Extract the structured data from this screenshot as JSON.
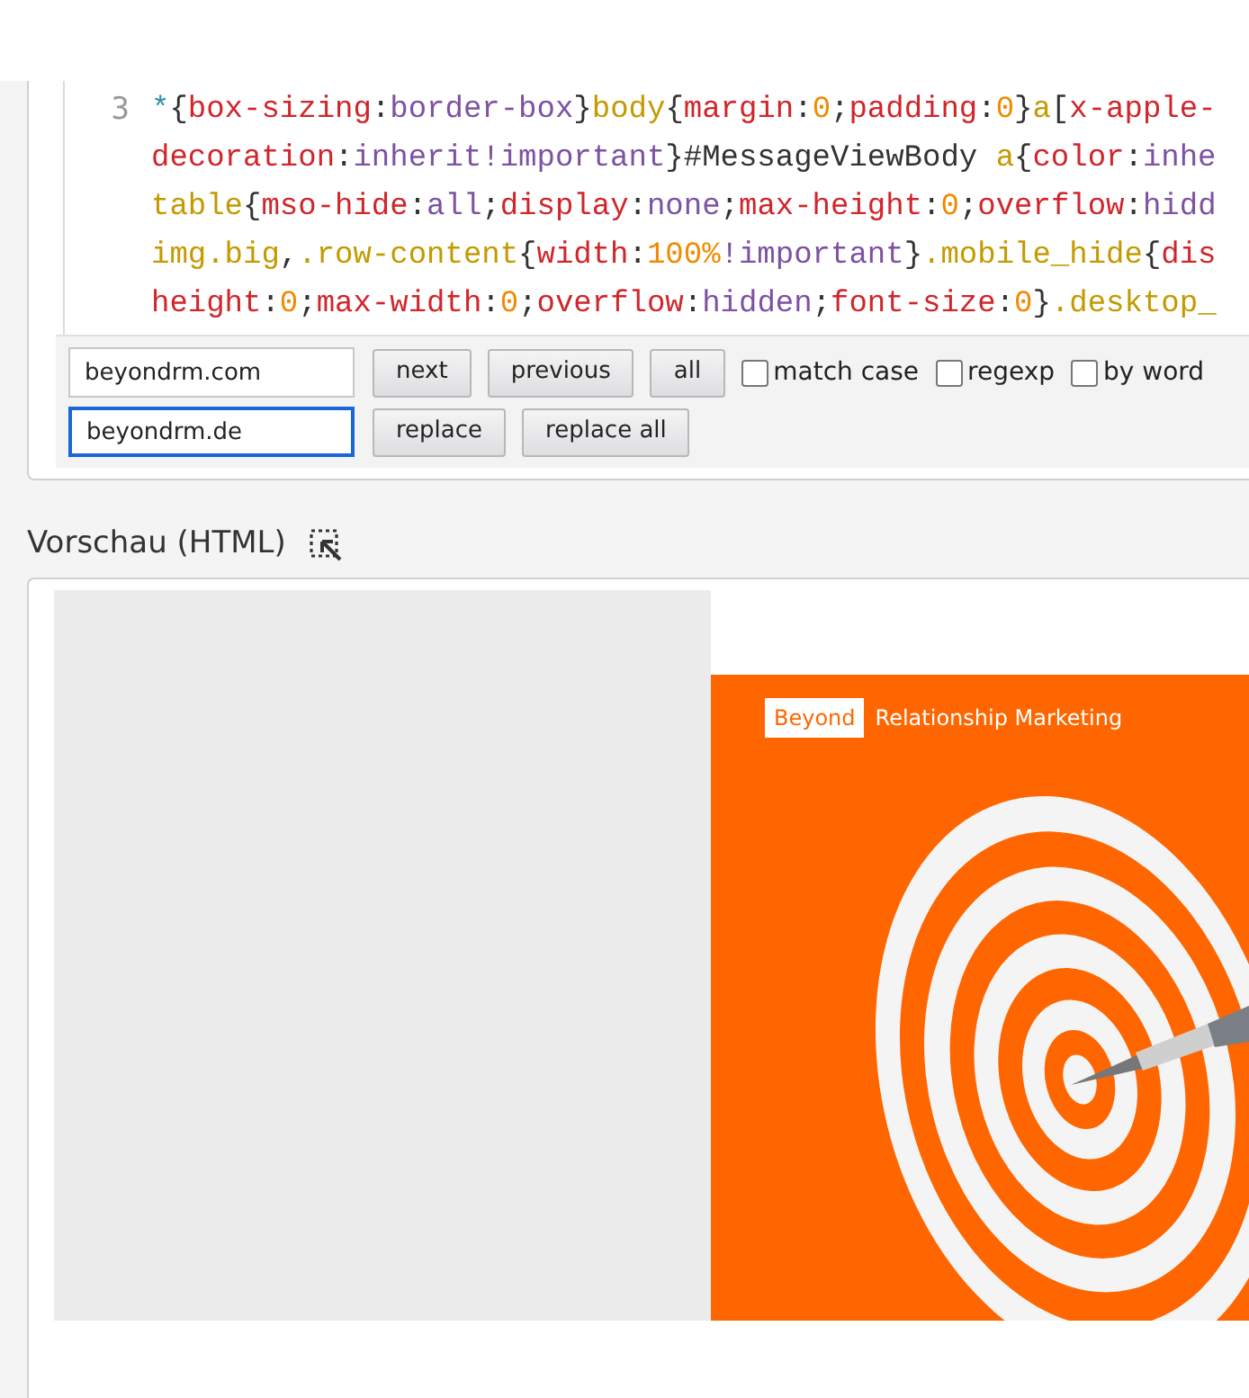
{
  "code_editor": {
    "lines": [
      {
        "number": "3",
        "rows": [
          {
            "tokens": [
              {
                "kind": "star",
                "text": "*"
              },
              {
                "kind": "punct",
                "text": "{"
              },
              {
                "kind": "prop",
                "text": "box-sizing"
              },
              {
                "kind": "punct",
                "text": ":"
              },
              {
                "kind": "value",
                "text": "border-box"
              },
              {
                "kind": "punct",
                "text": "}"
              },
              {
                "kind": "tag",
                "text": "body"
              },
              {
                "kind": "punct",
                "text": "{"
              },
              {
                "kind": "prop",
                "text": "margin"
              },
              {
                "kind": "punct",
                "text": ":"
              },
              {
                "kind": "num",
                "text": "0"
              },
              {
                "kind": "punct",
                "text": ";"
              },
              {
                "kind": "prop",
                "text": "padding"
              },
              {
                "kind": "punct",
                "text": ":"
              },
              {
                "kind": "num",
                "text": "0"
              },
              {
                "kind": "punct",
                "text": "}"
              },
              {
                "kind": "tag",
                "text": "a"
              },
              {
                "kind": "punct",
                "text": "["
              },
              {
                "kind": "prop",
                "text": "x-apple-"
              }
            ]
          },
          {
            "tokens": [
              {
                "kind": "prop",
                "text": "decoration"
              },
              {
                "kind": "punct",
                "text": ":"
              },
              {
                "kind": "value",
                "text": "inherit!important"
              },
              {
                "kind": "punct",
                "text": "}#MessageViewBody "
              },
              {
                "kind": "tag",
                "text": "a"
              },
              {
                "kind": "punct",
                "text": "{"
              },
              {
                "kind": "prop",
                "text": "color"
              },
              {
                "kind": "punct",
                "text": ":"
              },
              {
                "kind": "value",
                "text": "inhe"
              }
            ]
          },
          {
            "tokens": [
              {
                "kind": "tag",
                "text": "table"
              },
              {
                "kind": "punct",
                "text": "{"
              },
              {
                "kind": "prop",
                "text": "mso-hide"
              },
              {
                "kind": "punct",
                "text": ":"
              },
              {
                "kind": "value",
                "text": "all"
              },
              {
                "kind": "punct",
                "text": ";"
              },
              {
                "kind": "prop",
                "text": "display"
              },
              {
                "kind": "punct",
                "text": ":"
              },
              {
                "kind": "value",
                "text": "none"
              },
              {
                "kind": "punct",
                "text": ";"
              },
              {
                "kind": "prop",
                "text": "max-height"
              },
              {
                "kind": "punct",
                "text": ":"
              },
              {
                "kind": "num",
                "text": "0"
              },
              {
                "kind": "punct",
                "text": ";"
              },
              {
                "kind": "prop",
                "text": "overflow"
              },
              {
                "kind": "punct",
                "text": ":"
              },
              {
                "kind": "value",
                "text": "hidd"
              }
            ]
          },
          {
            "tokens": [
              {
                "kind": "tag",
                "text": "img.big"
              },
              {
                "kind": "punct",
                "text": ","
              },
              {
                "kind": "tag",
                "text": ".row-content"
              },
              {
                "kind": "punct",
                "text": "{"
              },
              {
                "kind": "prop",
                "text": "width"
              },
              {
                "kind": "punct",
                "text": ":"
              },
              {
                "kind": "num",
                "text": "100%"
              },
              {
                "kind": "value",
                "text": "!important"
              },
              {
                "kind": "punct",
                "text": "}"
              },
              {
                "kind": "tag",
                "text": ".mobile_hide"
              },
              {
                "kind": "punct",
                "text": "{"
              },
              {
                "kind": "prop",
                "text": "dis"
              }
            ]
          },
          {
            "tokens": [
              {
                "kind": "prop",
                "text": "height"
              },
              {
                "kind": "punct",
                "text": ":"
              },
              {
                "kind": "num",
                "text": "0"
              },
              {
                "kind": "punct",
                "text": ";"
              },
              {
                "kind": "prop",
                "text": "max-width"
              },
              {
                "kind": "punct",
                "text": ":"
              },
              {
                "kind": "num",
                "text": "0"
              },
              {
                "kind": "punct",
                "text": ";"
              },
              {
                "kind": "prop",
                "text": "overflow"
              },
              {
                "kind": "punct",
                "text": ":"
              },
              {
                "kind": "value",
                "text": "hidden"
              },
              {
                "kind": "punct",
                "text": ";"
              },
              {
                "kind": "prop",
                "text": "font-size"
              },
              {
                "kind": "punct",
                "text": ":"
              },
              {
                "kind": "num",
                "text": "0"
              },
              {
                "kind": "punct",
                "text": "}"
              },
              {
                "kind": "tag",
                "text": ".desktop_"
              }
            ]
          }
        ]
      }
    ]
  },
  "search_bar": {
    "find": {
      "value": "beyondrm.com",
      "focused": false
    },
    "replace": {
      "value": "beyondrm.de",
      "focused": true
    },
    "find_buttons": [
      "next",
      "previous",
      "all"
    ],
    "options": [
      {
        "label": "match case",
        "checked": false
      },
      {
        "label": "regexp",
        "checked": false
      },
      {
        "label": "by word",
        "checked": false
      }
    ],
    "replace_buttons": [
      "replace",
      "replace all"
    ]
  },
  "preview": {
    "title": "Vorschau (HTML)",
    "email": {
      "logo": "Beyond",
      "tagline": "Relationship Marketing"
    }
  }
}
